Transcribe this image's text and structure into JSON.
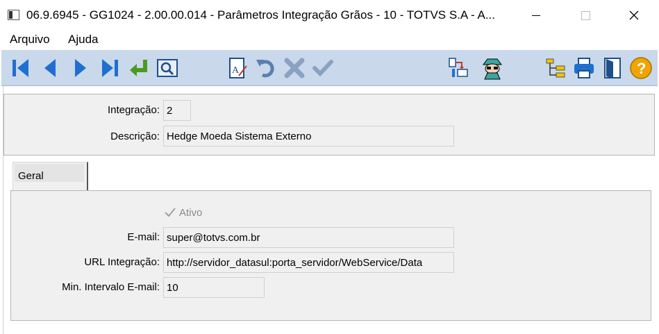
{
  "window": {
    "title": "06.9.6945 - GG1024 - 2.00.00.014 - Parâmetros Integração Grãos - 10 - TOTVS S.A - A..."
  },
  "menu": {
    "items": [
      {
        "label": "Arquivo"
      },
      {
        "label": "Ajuda"
      }
    ]
  },
  "toolbar": {
    "icons": [
      "first-record-icon",
      "previous-record-icon",
      "next-record-icon",
      "last-record-icon",
      "goto-icon",
      "search-icon",
      "edit-icon",
      "undo-icon",
      "delete-icon",
      "confirm-icon",
      "transfer-icon",
      "spy-icon",
      "tree-icon",
      "print-icon",
      "exit-icon",
      "help-icon"
    ]
  },
  "header": {
    "integracao_label": "Integração:",
    "integracao_value": "2",
    "descricao_label": "Descrição:",
    "descricao_value": "Hedge Moeda Sistema Externo"
  },
  "tabs": [
    {
      "label": "Geral",
      "selected": true
    }
  ],
  "geral": {
    "ativo_label": "Ativo",
    "ativo_checked": true,
    "email_label": "E-mail:",
    "email_value": "super@totvs.com.br",
    "url_label": "URL Integração:",
    "url_value": "http://servidor_datasul:porta_servidor/WebService/Data",
    "intervalo_label": "Min. Intervalo E-mail:",
    "intervalo_value": "10"
  },
  "colors": {
    "toolbar_bg": "#c9d8ea",
    "icon_blue": "#1f6fd1",
    "icon_green": "#4c9a1f",
    "help_orange": "#f0a400"
  }
}
